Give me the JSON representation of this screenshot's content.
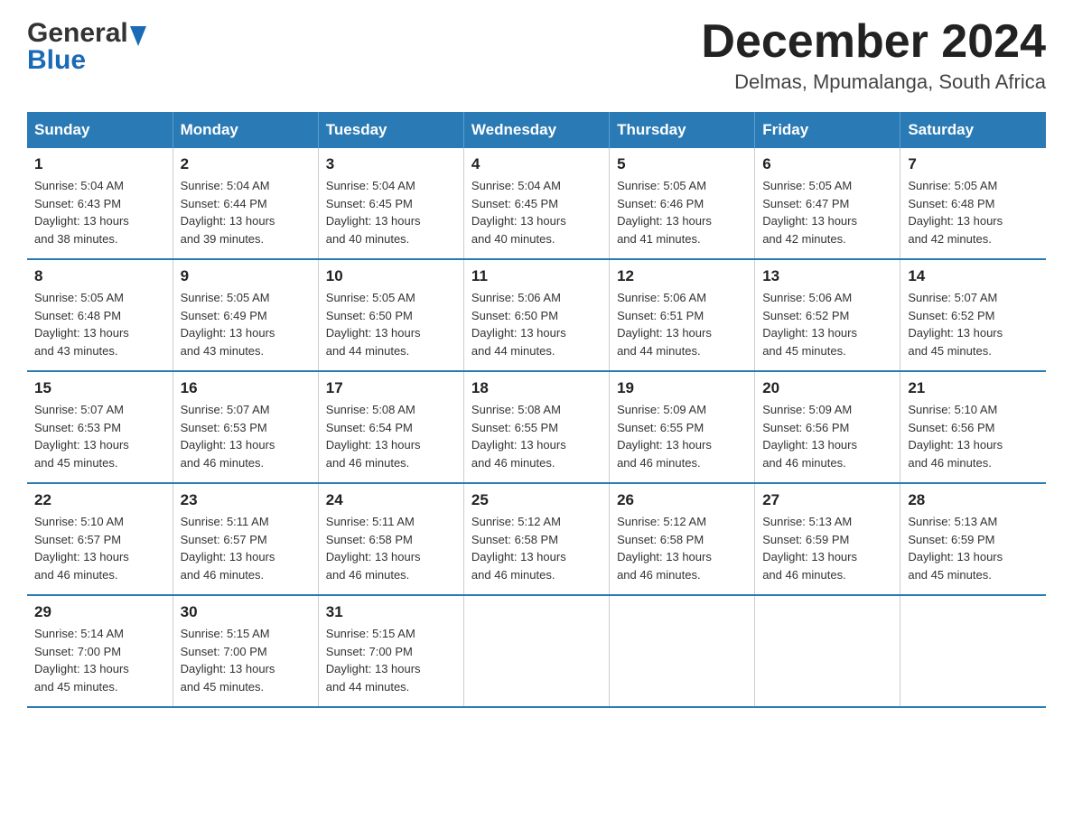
{
  "header": {
    "logo_general": "General",
    "logo_blue": "Blue",
    "month_title": "December 2024",
    "subtitle": "Delmas, Mpumalanga, South Africa"
  },
  "days_of_week": [
    "Sunday",
    "Monday",
    "Tuesday",
    "Wednesday",
    "Thursday",
    "Friday",
    "Saturday"
  ],
  "weeks": [
    [
      {
        "day": "1",
        "sunrise": "5:04 AM",
        "sunset": "6:43 PM",
        "daylight": "13 hours and 38 minutes."
      },
      {
        "day": "2",
        "sunrise": "5:04 AM",
        "sunset": "6:44 PM",
        "daylight": "13 hours and 39 minutes."
      },
      {
        "day": "3",
        "sunrise": "5:04 AM",
        "sunset": "6:45 PM",
        "daylight": "13 hours and 40 minutes."
      },
      {
        "day": "4",
        "sunrise": "5:04 AM",
        "sunset": "6:45 PM",
        "daylight": "13 hours and 40 minutes."
      },
      {
        "day": "5",
        "sunrise": "5:05 AM",
        "sunset": "6:46 PM",
        "daylight": "13 hours and 41 minutes."
      },
      {
        "day": "6",
        "sunrise": "5:05 AM",
        "sunset": "6:47 PM",
        "daylight": "13 hours and 42 minutes."
      },
      {
        "day": "7",
        "sunrise": "5:05 AM",
        "sunset": "6:48 PM",
        "daylight": "13 hours and 42 minutes."
      }
    ],
    [
      {
        "day": "8",
        "sunrise": "5:05 AM",
        "sunset": "6:48 PM",
        "daylight": "13 hours and 43 minutes."
      },
      {
        "day": "9",
        "sunrise": "5:05 AM",
        "sunset": "6:49 PM",
        "daylight": "13 hours and 43 minutes."
      },
      {
        "day": "10",
        "sunrise": "5:05 AM",
        "sunset": "6:50 PM",
        "daylight": "13 hours and 44 minutes."
      },
      {
        "day": "11",
        "sunrise": "5:06 AM",
        "sunset": "6:50 PM",
        "daylight": "13 hours and 44 minutes."
      },
      {
        "day": "12",
        "sunrise": "5:06 AM",
        "sunset": "6:51 PM",
        "daylight": "13 hours and 44 minutes."
      },
      {
        "day": "13",
        "sunrise": "5:06 AM",
        "sunset": "6:52 PM",
        "daylight": "13 hours and 45 minutes."
      },
      {
        "day": "14",
        "sunrise": "5:07 AM",
        "sunset": "6:52 PM",
        "daylight": "13 hours and 45 minutes."
      }
    ],
    [
      {
        "day": "15",
        "sunrise": "5:07 AM",
        "sunset": "6:53 PM",
        "daylight": "13 hours and 45 minutes."
      },
      {
        "day": "16",
        "sunrise": "5:07 AM",
        "sunset": "6:53 PM",
        "daylight": "13 hours and 46 minutes."
      },
      {
        "day": "17",
        "sunrise": "5:08 AM",
        "sunset": "6:54 PM",
        "daylight": "13 hours and 46 minutes."
      },
      {
        "day": "18",
        "sunrise": "5:08 AM",
        "sunset": "6:55 PM",
        "daylight": "13 hours and 46 minutes."
      },
      {
        "day": "19",
        "sunrise": "5:09 AM",
        "sunset": "6:55 PM",
        "daylight": "13 hours and 46 minutes."
      },
      {
        "day": "20",
        "sunrise": "5:09 AM",
        "sunset": "6:56 PM",
        "daylight": "13 hours and 46 minutes."
      },
      {
        "day": "21",
        "sunrise": "5:10 AM",
        "sunset": "6:56 PM",
        "daylight": "13 hours and 46 minutes."
      }
    ],
    [
      {
        "day": "22",
        "sunrise": "5:10 AM",
        "sunset": "6:57 PM",
        "daylight": "13 hours and 46 minutes."
      },
      {
        "day": "23",
        "sunrise": "5:11 AM",
        "sunset": "6:57 PM",
        "daylight": "13 hours and 46 minutes."
      },
      {
        "day": "24",
        "sunrise": "5:11 AM",
        "sunset": "6:58 PM",
        "daylight": "13 hours and 46 minutes."
      },
      {
        "day": "25",
        "sunrise": "5:12 AM",
        "sunset": "6:58 PM",
        "daylight": "13 hours and 46 minutes."
      },
      {
        "day": "26",
        "sunrise": "5:12 AM",
        "sunset": "6:58 PM",
        "daylight": "13 hours and 46 minutes."
      },
      {
        "day": "27",
        "sunrise": "5:13 AM",
        "sunset": "6:59 PM",
        "daylight": "13 hours and 46 minutes."
      },
      {
        "day": "28",
        "sunrise": "5:13 AM",
        "sunset": "6:59 PM",
        "daylight": "13 hours and 45 minutes."
      }
    ],
    [
      {
        "day": "29",
        "sunrise": "5:14 AM",
        "sunset": "7:00 PM",
        "daylight": "13 hours and 45 minutes."
      },
      {
        "day": "30",
        "sunrise": "5:15 AM",
        "sunset": "7:00 PM",
        "daylight": "13 hours and 45 minutes."
      },
      {
        "day": "31",
        "sunrise": "5:15 AM",
        "sunset": "7:00 PM",
        "daylight": "13 hours and 44 minutes."
      },
      null,
      null,
      null,
      null
    ]
  ],
  "labels": {
    "sunrise": "Sunrise:",
    "sunset": "Sunset:",
    "daylight": "Daylight:"
  }
}
